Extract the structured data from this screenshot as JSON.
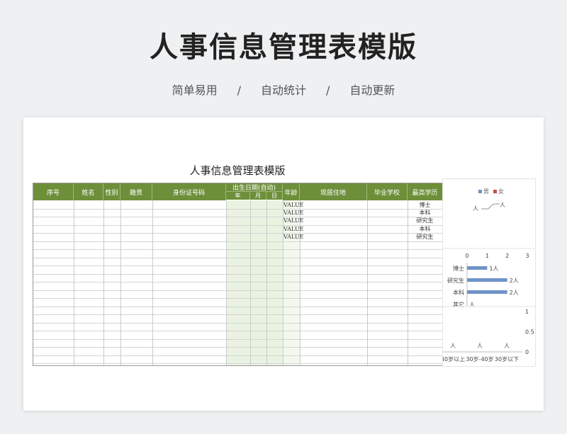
{
  "banner": {
    "title": "人事信息管理表模版",
    "tags": [
      "简单易用",
      "自动统计",
      "自动更新"
    ],
    "separator": "/"
  },
  "sheet": {
    "title": "人事信息管理表模版",
    "headers": {
      "seq": "序号",
      "name": "姓名",
      "gender": "性别",
      "origin": "籍贯",
      "id_number": "身份证号码",
      "birth": "出生日期(自动)",
      "year": "年",
      "month": "月",
      "day": "日",
      "age": "年龄",
      "address": "现居住地",
      "school": "毕业学校",
      "education": "最高学历"
    },
    "rows": [
      {
        "age": "VALUE",
        "education": "博士"
      },
      {
        "age": "VALUE",
        "education": "本科"
      },
      {
        "age": "VALUE",
        "education": "研究生"
      },
      {
        "age": "VALUE",
        "education": "本科"
      },
      {
        "age": "VALUE",
        "education": "研究生"
      }
    ]
  },
  "colors": {
    "header_green": "#6e8f3a",
    "date_col_fill": "#eaf3e2",
    "bar_blue": "#6f93c8",
    "female_red": "#c0504d"
  },
  "chart_data": [
    {
      "type": "line",
      "legend": [
        "男",
        "女"
      ],
      "point_labels": [
        "人",
        "人"
      ]
    },
    {
      "type": "bar",
      "orientation": "horizontal",
      "categories": [
        "博士",
        "研究生",
        "本科",
        "其它"
      ],
      "values": [
        1,
        2,
        2,
        0
      ],
      "data_labels": [
        "1人",
        "2人",
        "2人",
        "人"
      ],
      "xlim": [
        0,
        3
      ],
      "xticks": [
        "0",
        "1",
        "2",
        "3"
      ]
    },
    {
      "type": "bar",
      "categories": [
        "40岁以上",
        "30岁-40岁",
        "30岁以下"
      ],
      "values": [
        0,
        0,
        0
      ],
      "data_labels": [
        "人",
        "人",
        "人"
      ],
      "ylim": [
        0,
        1
      ],
      "yticks": [
        "0",
        "0.5",
        "1"
      ]
    }
  ]
}
